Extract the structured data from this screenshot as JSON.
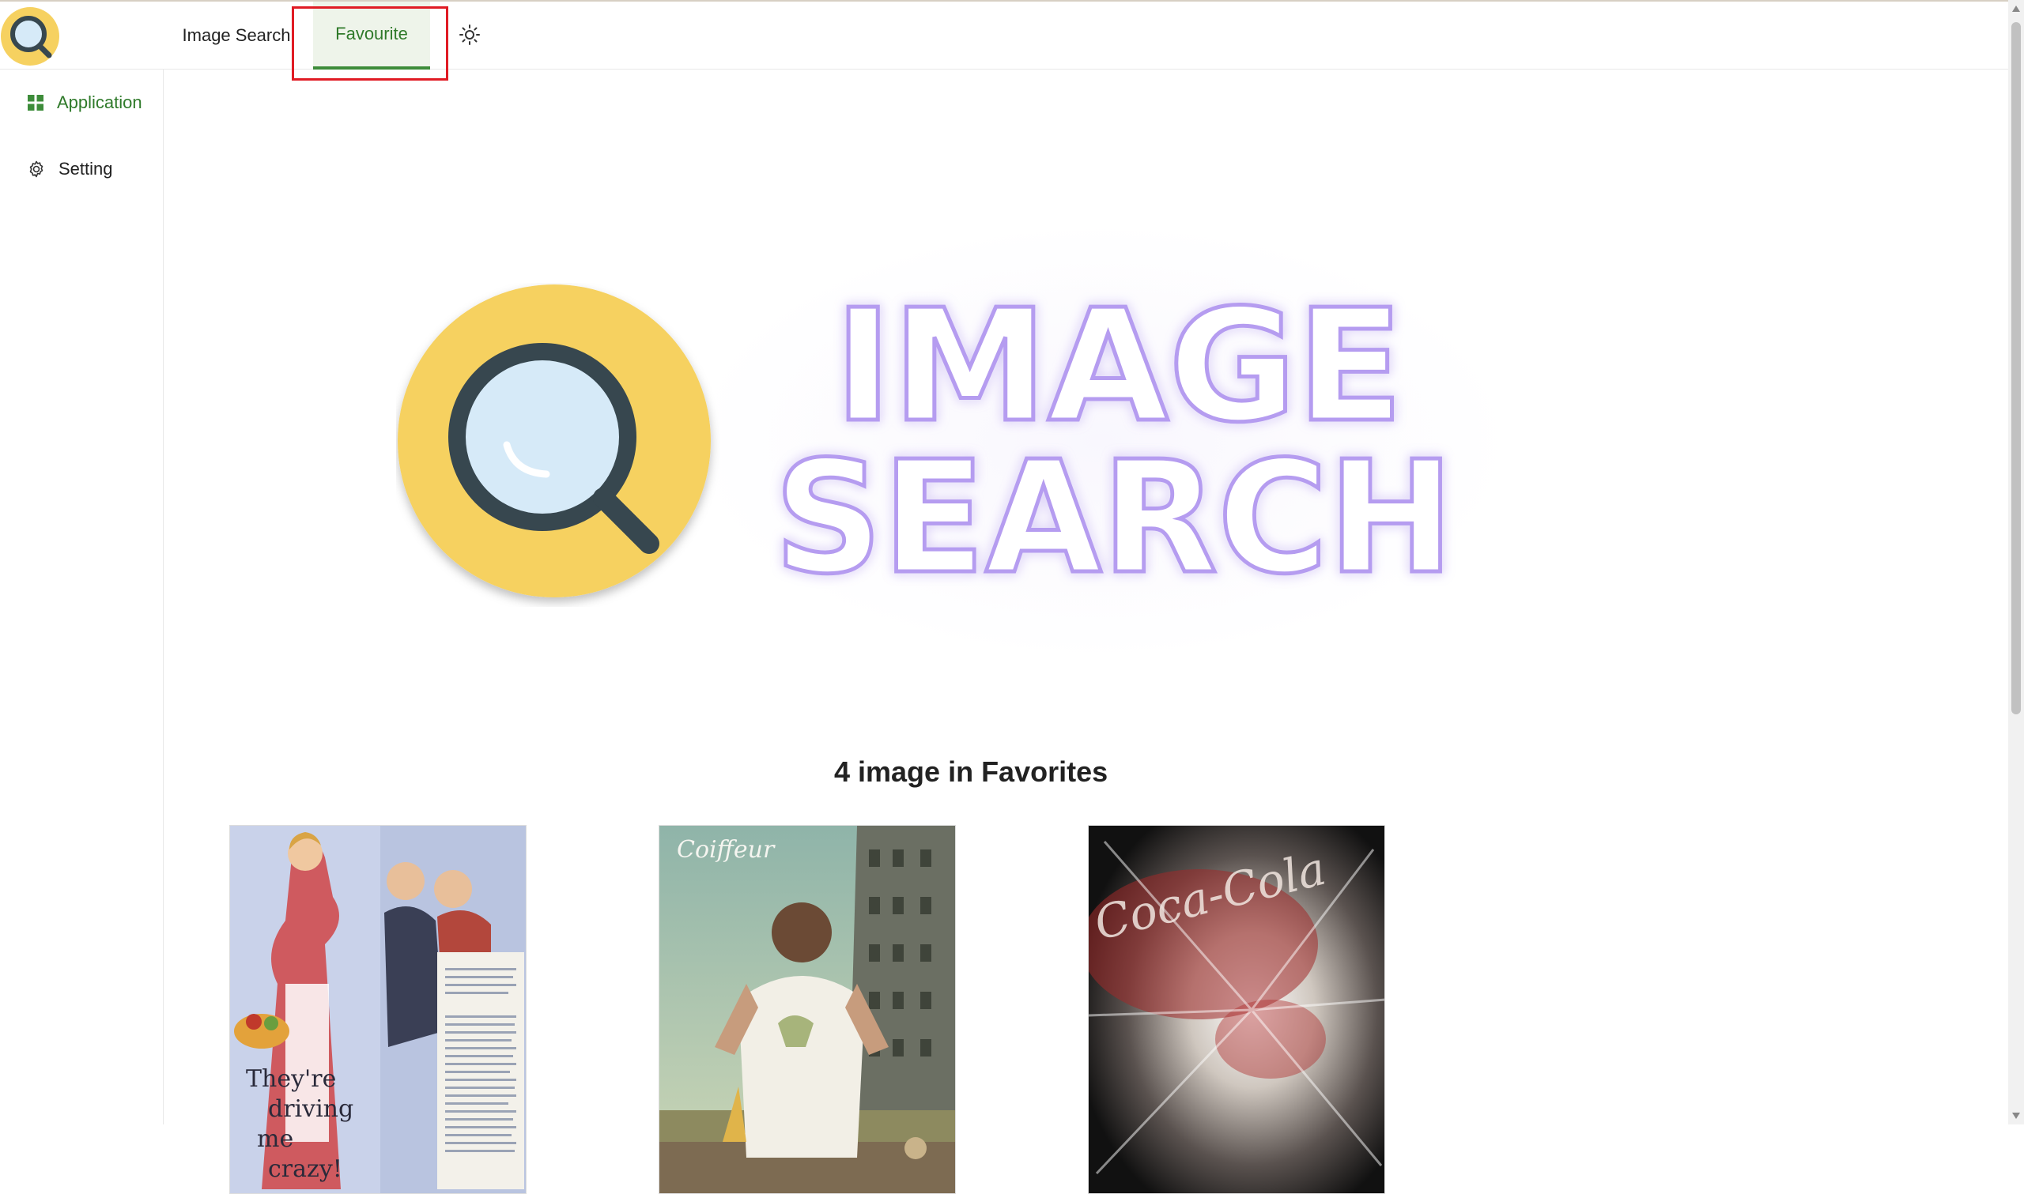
{
  "header": {
    "logo_icon": "magnifier-logo-icon",
    "tabs": [
      {
        "label": "Image Search"
      },
      {
        "label": "Favourite",
        "active": true
      }
    ],
    "theme_icon": "sun-icon"
  },
  "sidebar": {
    "items": [
      {
        "label": "Application",
        "icon": "grid-icon",
        "active": true
      },
      {
        "label": "Setting",
        "icon": "gear-icon"
      }
    ]
  },
  "banner": {
    "line1": "IMAGE",
    "line2": "SEARCH",
    "icon": "magnifier-logo-icon"
  },
  "favorites": {
    "title": "4 image in Favorites",
    "images": [
      {
        "caption_lines": [
          "They're",
          "driving",
          "me",
          "crazy!"
        ]
      },
      {
        "brand": "Coiffeur"
      },
      {
        "brand": "Coca-Cola"
      }
    ]
  },
  "colors": {
    "accent_green": "#2f7a2a",
    "highlight_red": "#e01b24",
    "logo_yellow": "#f6d160",
    "logo_ring": "#37474f",
    "neon_purple": "#b59cf0"
  }
}
